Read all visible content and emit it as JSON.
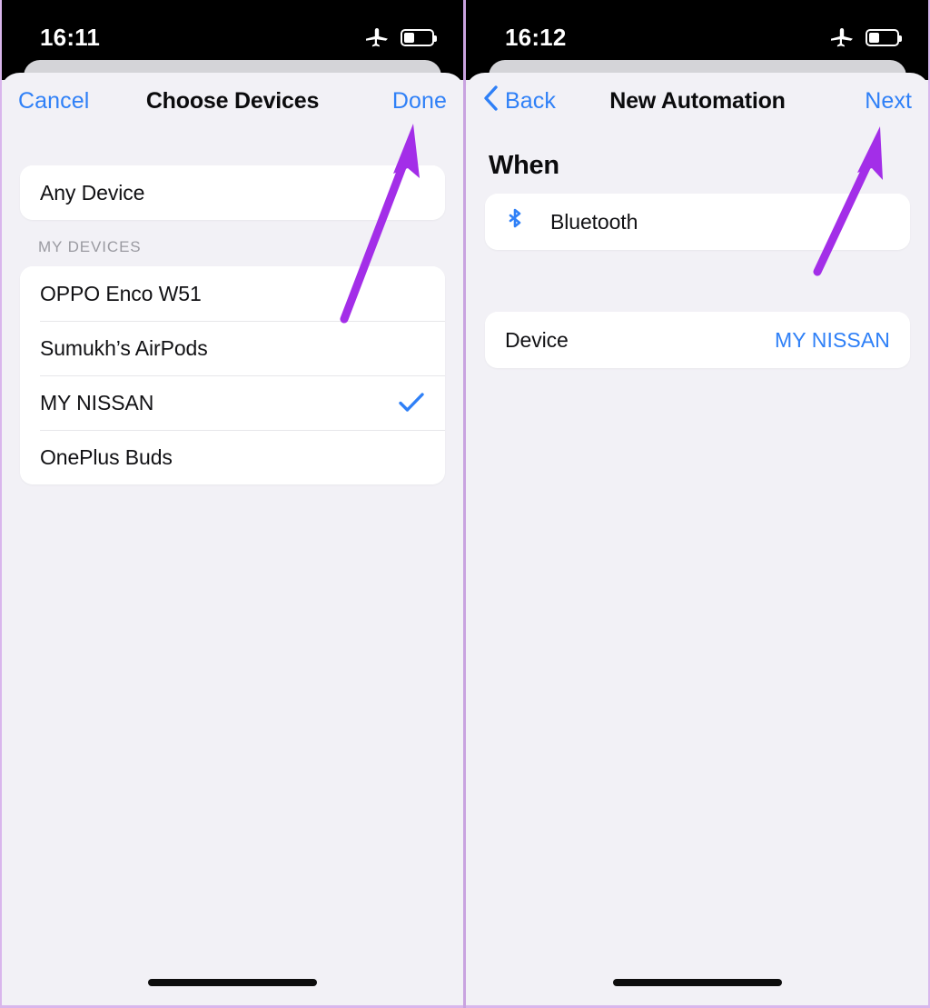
{
  "panels": [
    {
      "id": "choose-devices",
      "status_bar": {
        "time": "16:11",
        "airplane_icon": "airplane-icon",
        "battery_icon": "battery-icon",
        "battery_level_pct": 38
      },
      "navbar": {
        "left_label": "Cancel",
        "title": "Choose Devices",
        "right_label": "Done",
        "has_back_chevron": false
      },
      "any_device": {
        "label": "Any Device"
      },
      "group_label": "MY DEVICES",
      "devices": [
        {
          "label": "OPPO Enco W51",
          "selected": false
        },
        {
          "label": "Sumukh’s AirPods",
          "selected": false
        },
        {
          "label": "MY NISSAN",
          "selected": true
        },
        {
          "label": "OnePlus Buds",
          "selected": false
        }
      ],
      "check_icon": "checkmark-icon"
    },
    {
      "id": "new-automation",
      "status_bar": {
        "time": "16:12",
        "airplane_icon": "airplane-icon",
        "battery_icon": "battery-icon",
        "battery_level_pct": 38
      },
      "navbar": {
        "left_label": "Back",
        "title": "New Automation",
        "right_label": "Next",
        "has_back_chevron": true
      },
      "section_heading": "When",
      "trigger": {
        "icon": "bluetooth-icon",
        "label": "Bluetooth"
      },
      "device_row": {
        "label": "Device",
        "value": "MY NISSAN"
      }
    }
  ],
  "annotations": [
    {
      "name": "arrow-to-done",
      "points_to": "Done"
    },
    {
      "name": "arrow-to-next",
      "points_to": "Next"
    }
  ],
  "colors": {
    "accent_blue": "#2f80f7",
    "annotation_purple": "#a32ee8",
    "sheet_bg": "#f2f1f6",
    "card_bg": "#ffffff",
    "frame_purple": "#d9b6ec",
    "status_bar_bg": "#000000"
  }
}
